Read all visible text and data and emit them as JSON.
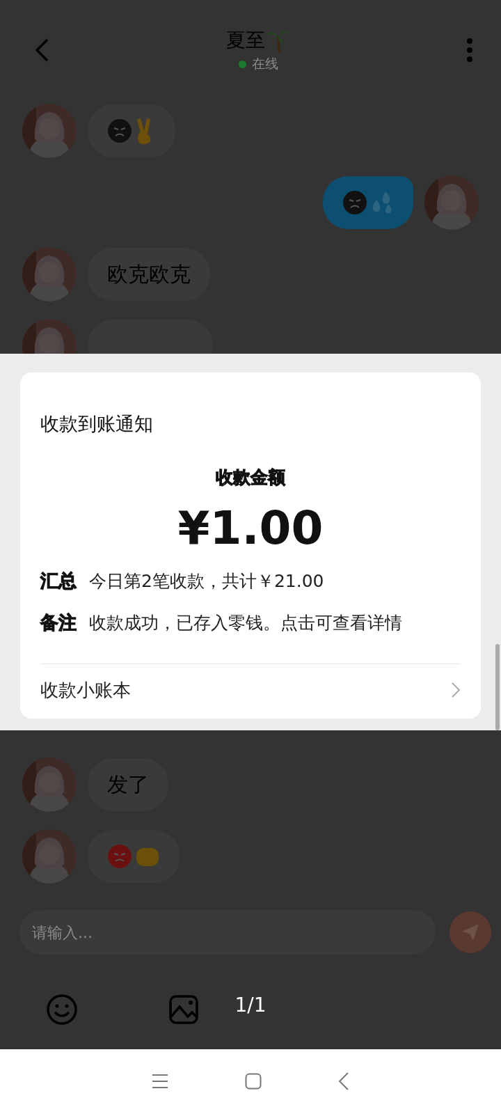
{
  "header": {
    "title": "夏至",
    "status": "在线",
    "online": true
  },
  "messages": [
    {
      "sent": false,
      "kind": "emoji"
    },
    {
      "sent": true,
      "kind": "emoji"
    },
    {
      "sent": false,
      "kind": "text",
      "text": "欧克欧克"
    },
    {
      "sent": false,
      "kind": "hidden"
    },
    {
      "sent": false,
      "kind": "text",
      "text": "发了"
    },
    {
      "sent": false,
      "kind": "emoji"
    }
  ],
  "input": {
    "placeholder": "请输入..."
  },
  "viewer": {
    "counter": "1/1",
    "card": {
      "title": "收款到账通知",
      "amount_label": "收款金额",
      "amount": "¥1.00",
      "rows": [
        {
          "label": "汇总",
          "value": "今日第2笔收款，共计￥21.00"
        },
        {
          "label": "备注",
          "value": "收款成功，已存入零钱。点击可查看详情"
        }
      ],
      "link": "收款小账本"
    }
  }
}
